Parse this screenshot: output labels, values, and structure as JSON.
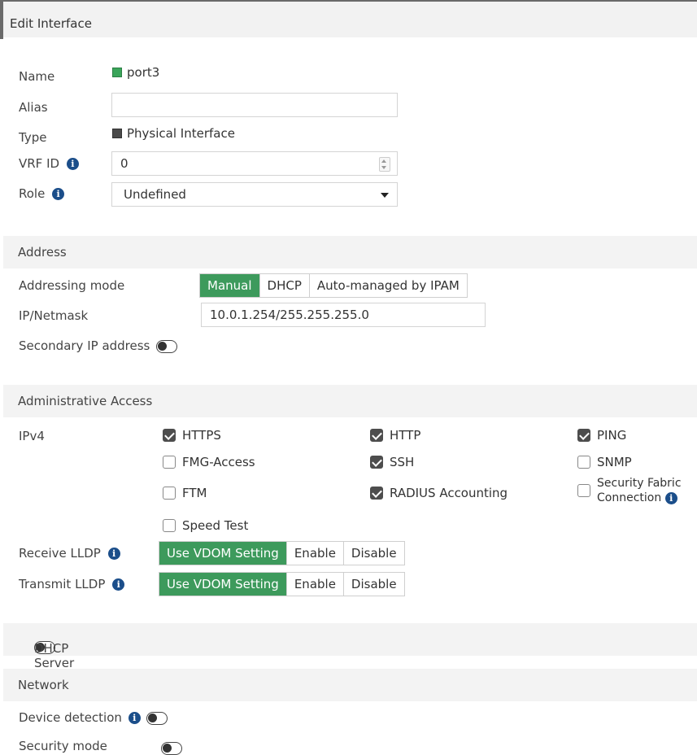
{
  "window": {
    "title": "Edit Interface"
  },
  "general": {
    "name_label": "Name",
    "name_value": "port3",
    "alias_label": "Alias",
    "alias_value": "",
    "type_label": "Type",
    "type_value": "Physical Interface",
    "vrf_label": "VRF ID",
    "vrf_value": "0",
    "role_label": "Role",
    "role_value": "Undefined"
  },
  "address": {
    "section_title": "Address",
    "mode_label": "Addressing mode",
    "modes": [
      "Manual",
      "DHCP",
      "Auto-managed by IPAM"
    ],
    "selected_mode": "Manual",
    "ip_label": "IP/Netmask",
    "ip_value": "10.0.1.254/255.255.255.0",
    "secondary_label": "Secondary IP address",
    "secondary_enabled": false
  },
  "admin_access": {
    "section_title": "Administrative Access",
    "ipv4_label": "IPv4",
    "options": [
      {
        "label": "HTTPS",
        "checked": true
      },
      {
        "label": "HTTP",
        "checked": true
      },
      {
        "label": "PING",
        "checked": true
      },
      {
        "label": "FMG-Access",
        "checked": false
      },
      {
        "label": "SSH",
        "checked": true
      },
      {
        "label": "SNMP",
        "checked": false
      },
      {
        "label": "FTM",
        "checked": false
      },
      {
        "label": "RADIUS Accounting",
        "checked": true
      },
      {
        "label_line1": "Security Fabric",
        "label_line2": "Connection",
        "checked": false
      },
      {
        "label": "Speed Test",
        "checked": false
      }
    ],
    "receive_lldp_label": "Receive LLDP",
    "transmit_lldp_label": "Transmit LLDP",
    "lldp_options": [
      "Use VDOM Setting",
      "Enable",
      "Disable"
    ],
    "receive_lldp_selected": "Use VDOM Setting",
    "transmit_lldp_selected": "Use VDOM Setting"
  },
  "dhcp": {
    "label": "DHCP Server",
    "enabled": false
  },
  "network": {
    "section_title": "Network",
    "device_detection_label": "Device detection",
    "device_detection_enabled": false,
    "security_mode_label": "Security mode",
    "security_mode_enabled": false
  },
  "colors": {
    "accent_green": "#3d9a5c",
    "info_blue": "#1b4e8a",
    "section_bg": "#f3f3f3"
  }
}
